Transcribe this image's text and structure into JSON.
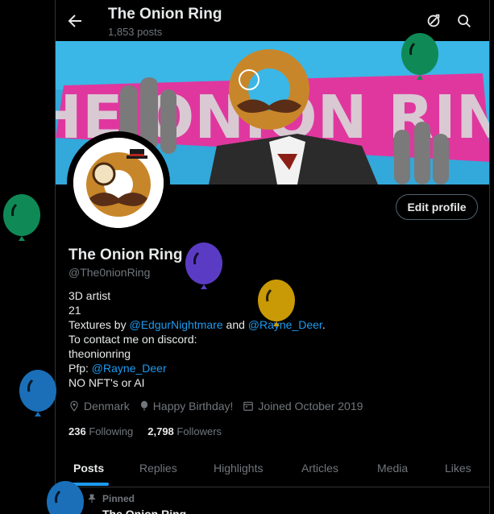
{
  "header": {
    "title": "The Onion Ring",
    "post_count": "1,853 posts",
    "back_icon": "arrow-left-icon",
    "right_icons": [
      "refresh-circle-icon",
      "search-icon"
    ]
  },
  "banner": {
    "text": "THE ONION RING",
    "colors": {
      "sky": "#3ab7e6",
      "pink": "#e0379f",
      "gray": "#8a8a8a"
    }
  },
  "profile": {
    "edit_button": "Edit profile",
    "name": "The Onion Ring",
    "handle": "@The0nionRing",
    "bio": {
      "line1": "3D artist",
      "line2": "21",
      "line3_prefix": "Textures by ",
      "line3_link1": "@EdgurNightmare",
      "line3_mid": " and ",
      "line3_link2": "@Rayne_Deer",
      "line3_suffix": ".",
      "line4": "To contact me on discord:",
      "line5": "theonionring",
      "line6_prefix": "Pfp: ",
      "line6_link": "@Rayne_Deer",
      "line7": "NO NFT's or AI"
    },
    "meta": {
      "location": "Denmark",
      "birthday": "Happy Birthday!",
      "joined": "Joined October 2019"
    },
    "following_count": "236",
    "following_label": "Following",
    "followers_count": "2,798",
    "followers_label": "Followers"
  },
  "tabs": [
    "Posts",
    "Replies",
    "Highlights",
    "Articles",
    "Media",
    "Likes"
  ],
  "active_tab": "Posts",
  "pinned": {
    "label": "Pinned",
    "peek": "The Onion Ring"
  },
  "accent": "#1d9bf0",
  "balloon_colors": [
    "#0f8a56",
    "#5a3cc4",
    "#c99a05",
    "#1a6fb8"
  ]
}
